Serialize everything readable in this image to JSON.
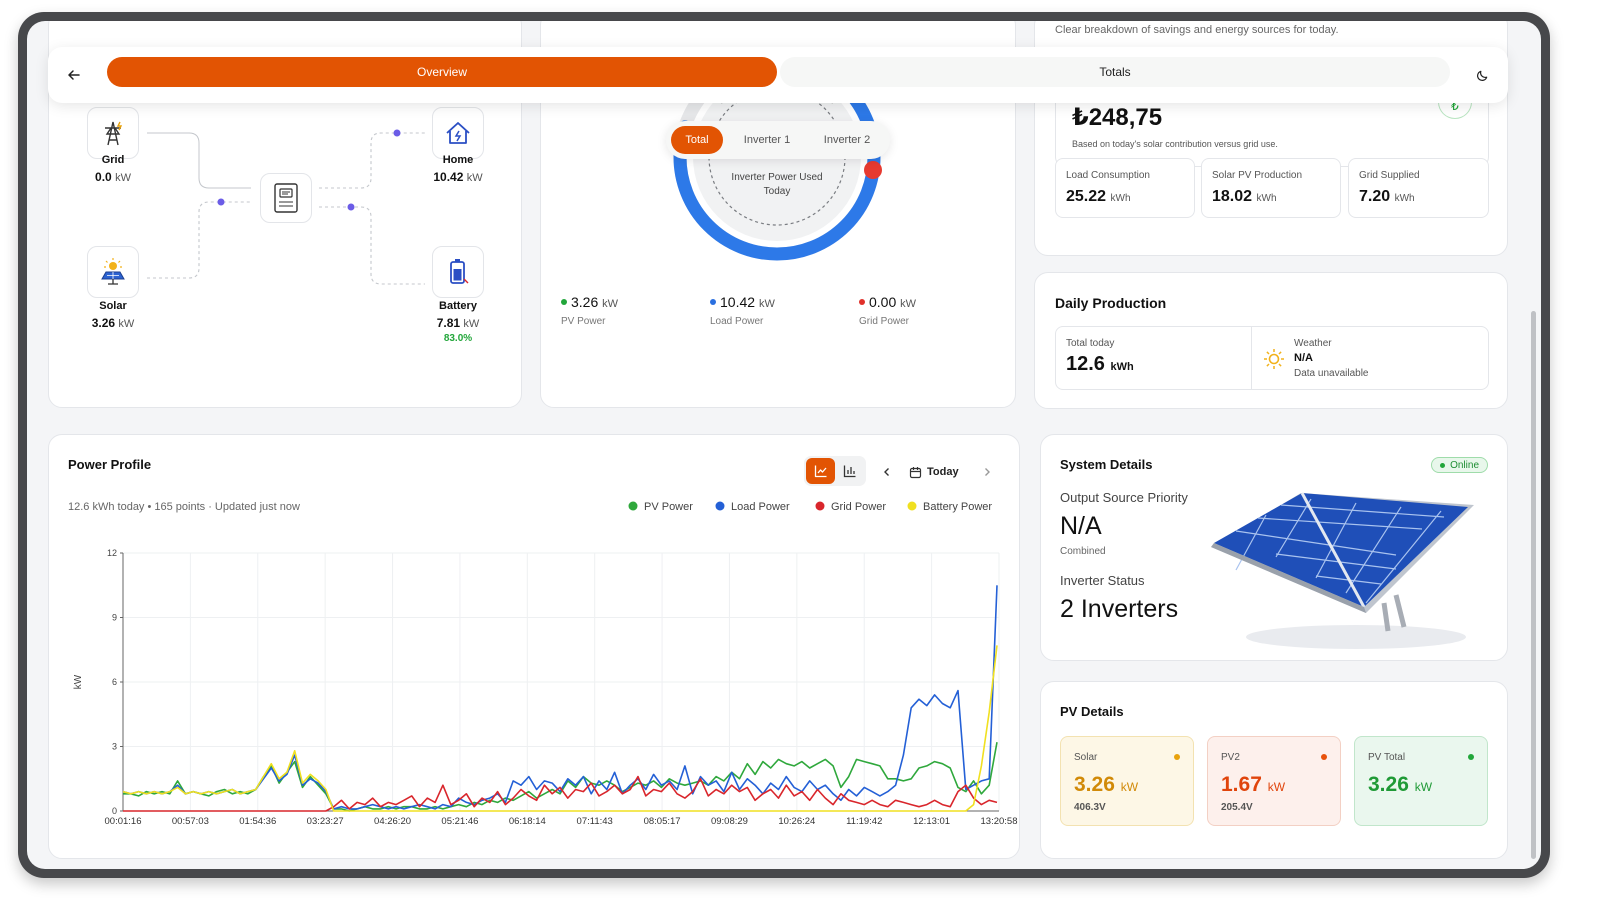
{
  "nav": {
    "overview_tab": "Overview",
    "totals_tab": "Totals"
  },
  "flow": {
    "grid": {
      "label": "Grid",
      "value": "0.0",
      "unit": "kW"
    },
    "home": {
      "label": "Home",
      "value": "10.42",
      "unit": "kW"
    },
    "solar": {
      "label": "Solar",
      "value": "3.26",
      "unit": "kW"
    },
    "battery": {
      "label": "Battery",
      "value": "7.81",
      "unit": "kW",
      "soc": "83.0%"
    }
  },
  "inverter": {
    "tabs": [
      "Total",
      "Inverter 1",
      "Inverter 2"
    ],
    "gauge_label_line1": "Inverter Power Used",
    "gauge_label_line2": "Today",
    "gauge_fill_fraction": 0.8,
    "metrics": [
      {
        "value": "3.26",
        "unit": "kW",
        "label": "PV Power",
        "color": "#22a63a"
      },
      {
        "value": "10.42",
        "unit": "kW",
        "label": "Load Power",
        "color": "#2a6fe0"
      },
      {
        "value": "0.00",
        "unit": "kW",
        "label": "Grid Power",
        "color": "#e0302a"
      }
    ]
  },
  "savings": {
    "subtitle": "Clear breakdown of savings and energy sources for today.",
    "amount": "₺248,75",
    "note": "Based on today's solar contribution versus grid use.",
    "stats": [
      {
        "label": "Load Consumption",
        "value": "25.22",
        "unit": "kWh"
      },
      {
        "label": "Solar PV Production",
        "value": "18.02",
        "unit": "kWh"
      },
      {
        "label": "Grid Supplied",
        "value": "7.20",
        "unit": "kWh"
      }
    ]
  },
  "daily": {
    "title": "Daily Production",
    "total_label": "Total today",
    "total_value": "12.6",
    "total_unit": "kWh",
    "weather_label": "Weather",
    "weather_value": "N/A",
    "weather_note": "Data unavailable"
  },
  "profile": {
    "title": "Power Profile",
    "summary": "12.6 kWh today • 165 points · Updated just now",
    "date_label": "Today"
  },
  "system": {
    "title": "System Details",
    "status": "Online",
    "osp_label": "Output Source Priority",
    "osp_value": "N/A",
    "osp_note": "Combined",
    "inv_label": "Inverter Status",
    "inv_value": "2 Inverters"
  },
  "pv": {
    "title": "PV Details",
    "items": [
      {
        "label": "Solar",
        "value": "3.26",
        "unit": "kW",
        "sub": "406.3V",
        "color": "#e8860c"
      },
      {
        "label": "PV2",
        "value": "1.67",
        "unit": "kW",
        "sub": "205.4V",
        "color": "#e8520c"
      },
      {
        "label": "PV Total",
        "value": "3.26",
        "unit": "kW",
        "sub": "",
        "color": "#22a63a"
      }
    ]
  },
  "chart_data": {
    "type": "line",
    "title": "",
    "ylabel": "kW",
    "xlabel": "",
    "ylim": [
      0,
      12
    ],
    "yticks": [
      "0",
      "3",
      "6",
      "9",
      "12"
    ],
    "xticks": [
      "00:01:16",
      "00:57:03",
      "01:54:36",
      "03:23:27",
      "04:26:20",
      "05:21:46",
      "06:18:14",
      "07:11:43",
      "08:05:17",
      "09:08:29",
      "10:26:24",
      "11:19:42",
      "12:13:01",
      "13:20:58"
    ],
    "legend": "top-right",
    "series": [
      {
        "name": "PV Power",
        "color": "#2fa83c",
        "values": [
          0.8,
          0.8,
          0.7,
          0.9,
          0.8,
          0.9,
          0.8,
          1.4,
          0.8,
          0.9,
          0.8,
          0.7,
          0.9,
          1.0,
          0.8,
          0.9,
          0.8,
          1.0,
          1.6,
          2.1,
          1.3,
          1.8,
          2.3,
          1.1,
          1.6,
          1.2,
          0.8,
          0.1,
          0.1,
          0.0,
          0.1,
          0.2,
          0.1,
          0.1,
          0.2,
          0.1,
          0.2,
          0.2,
          0.1,
          0.1,
          0.2,
          0.1,
          0.2,
          0.3,
          0.2,
          0.4,
          0.3,
          0.5,
          0.4,
          0.6,
          0.5,
          0.7,
          0.9,
          0.6,
          0.8,
          1.0,
          0.8,
          1.4,
          1.1,
          1.6,
          1.3,
          1.2,
          1.4,
          1.2,
          0.9,
          1.1,
          1.3,
          1.2,
          1.4,
          1.1,
          1.5,
          1.3,
          1.2,
          1.3,
          1.4,
          1.2,
          1.6,
          1.4,
          1.8,
          1.5,
          2.2,
          1.7,
          2.3,
          2.0,
          2.4,
          2.2,
          2.1,
          2.3,
          2.0,
          2.2,
          2.4,
          2.1,
          1.1,
          1.6,
          2.4,
          2.3,
          2.2,
          2.1,
          1.5,
          1.5,
          1.4,
          1.5,
          2.0,
          2.1,
          2.3,
          2.2,
          2.0,
          1.1,
          0.9,
          1.4,
          0.8,
          1.2,
          3.2
        ]
      },
      {
        "name": "Load Power",
        "color": "#2460d6",
        "values": [
          0.9,
          0.8,
          0.9,
          0.8,
          0.9,
          0.8,
          0.9,
          1.2,
          0.8,
          0.9,
          0.8,
          0.9,
          0.8,
          0.9,
          1.0,
          0.8,
          0.9,
          1.0,
          1.5,
          2.0,
          1.4,
          1.7,
          2.6,
          1.2,
          1.5,
          1.3,
          0.9,
          0.1,
          0.2,
          0.1,
          0.1,
          0.2,
          0.3,
          0.2,
          0.1,
          0.2,
          0.1,
          0.2,
          0.3,
          0.2,
          0.1,
          0.3,
          0.2,
          0.6,
          0.4,
          0.3,
          0.5,
          0.6,
          0.8,
          0.4,
          1.4,
          1.2,
          1.6,
          1.0,
          1.4,
          1.3,
          0.9,
          1.5,
          1.2,
          1.6,
          0.8,
          1.4,
          1.0,
          1.8,
          0.8,
          1.2,
          1.5,
          1.0,
          1.7,
          1.2,
          1.4,
          1.0,
          2.1,
          0.8,
          1.6,
          1.2,
          1.4,
          0.9,
          1.8,
          1.0,
          1.5,
          1.2,
          0.8,
          1.3,
          1.0,
          1.6,
          1.1,
          0.9,
          1.4,
          1.0,
          1.2,
          0.8,
          0.5,
          1.0,
          0.7,
          1.1,
          0.9,
          0.7,
          0.9,
          1.2,
          2.6,
          4.8,
          5.2,
          4.9,
          5.4,
          5.0,
          4.8,
          5.6,
          1.0,
          1.2,
          1.4,
          1.5,
          10.5
        ]
      },
      {
        "name": "Grid Power",
        "color": "#d9262c",
        "values": [
          0.0,
          0.0,
          0.0,
          0.0,
          0.0,
          0.0,
          0.0,
          0.0,
          0.0,
          0.0,
          0.0,
          0.0,
          0.0,
          0.0,
          0.0,
          0.0,
          0.0,
          0.0,
          0.0,
          0.0,
          0.0,
          0.0,
          0.0,
          0.0,
          0.0,
          0.0,
          0.0,
          0.2,
          0.5,
          0.1,
          0.4,
          0.3,
          0.6,
          0.2,
          0.4,
          0.3,
          0.5,
          0.7,
          0.2,
          0.6,
          0.4,
          1.2,
          0.3,
          0.5,
          0.8,
          0.2,
          0.6,
          0.4,
          0.9,
          0.3,
          0.6,
          1.0,
          0.7,
          0.5,
          1.2,
          0.8,
          1.1,
          0.6,
          1.0,
          0.9,
          1.3,
          0.7,
          0.9,
          1.2,
          0.8,
          1.0,
          1.6,
          0.7,
          1.0,
          0.9,
          1.3,
          0.8,
          0.6,
          0.9,
          1.5,
          0.7,
          1.0,
          0.8,
          1.2,
          0.9,
          1.1,
          0.5,
          0.8,
          1.0,
          0.6,
          1.2,
          0.7,
          0.9,
          0.5,
          1.0,
          0.6,
          0.3,
          0.8,
          0.5,
          0.4,
          0.3,
          0.5,
          0.3,
          0.2,
          0.5,
          0.4,
          0.3,
          0.2,
          0.3,
          0.5,
          0.3,
          0.2,
          0.9,
          1.2,
          0.6,
          0.3,
          0.5,
          0.4
        ]
      },
      {
        "name": "Battery Power",
        "color": "#f0e020",
        "values": [
          0.9,
          0.8,
          0.9,
          0.8,
          0.9,
          0.8,
          0.9,
          1.1,
          0.8,
          0.9,
          0.8,
          0.9,
          0.8,
          0.9,
          1.0,
          0.8,
          0.9,
          1.0,
          1.6,
          2.2,
          1.5,
          1.8,
          2.8,
          1.3,
          1.7,
          1.4,
          1.0,
          0.0,
          0.0,
          0.0,
          0.0,
          0.0,
          0.0,
          0.0,
          0.0,
          0.0,
          0.0,
          0.0,
          0.0,
          0.0,
          0.0,
          0.0,
          0.0,
          0.0,
          0.0,
          0.0,
          0.0,
          0.0,
          0.0,
          0.0,
          0.0,
          0.0,
          0.0,
          0.0,
          0.0,
          0.0,
          0.0,
          0.0,
          0.0,
          0.0,
          0.0,
          0.0,
          0.0,
          0.0,
          0.0,
          0.0,
          0.0,
          0.0,
          0.0,
          0.0,
          0.0,
          0.0,
          0.0,
          0.0,
          0.0,
          0.0,
          0.0,
          0.0,
          0.0,
          0.0,
          0.0,
          0.0,
          0.0,
          0.0,
          0.0,
          0.0,
          0.0,
          0.0,
          0.0,
          0.0,
          0.0,
          0.0,
          0.0,
          0.0,
          0.0,
          0.0,
          0.0,
          0.0,
          0.0,
          0.0,
          0.0,
          0.0,
          0.0,
          0.0,
          0.0,
          0.0,
          0.0,
          0.0,
          0.0,
          0.3,
          2.1,
          4.6,
          7.7
        ]
      }
    ]
  }
}
